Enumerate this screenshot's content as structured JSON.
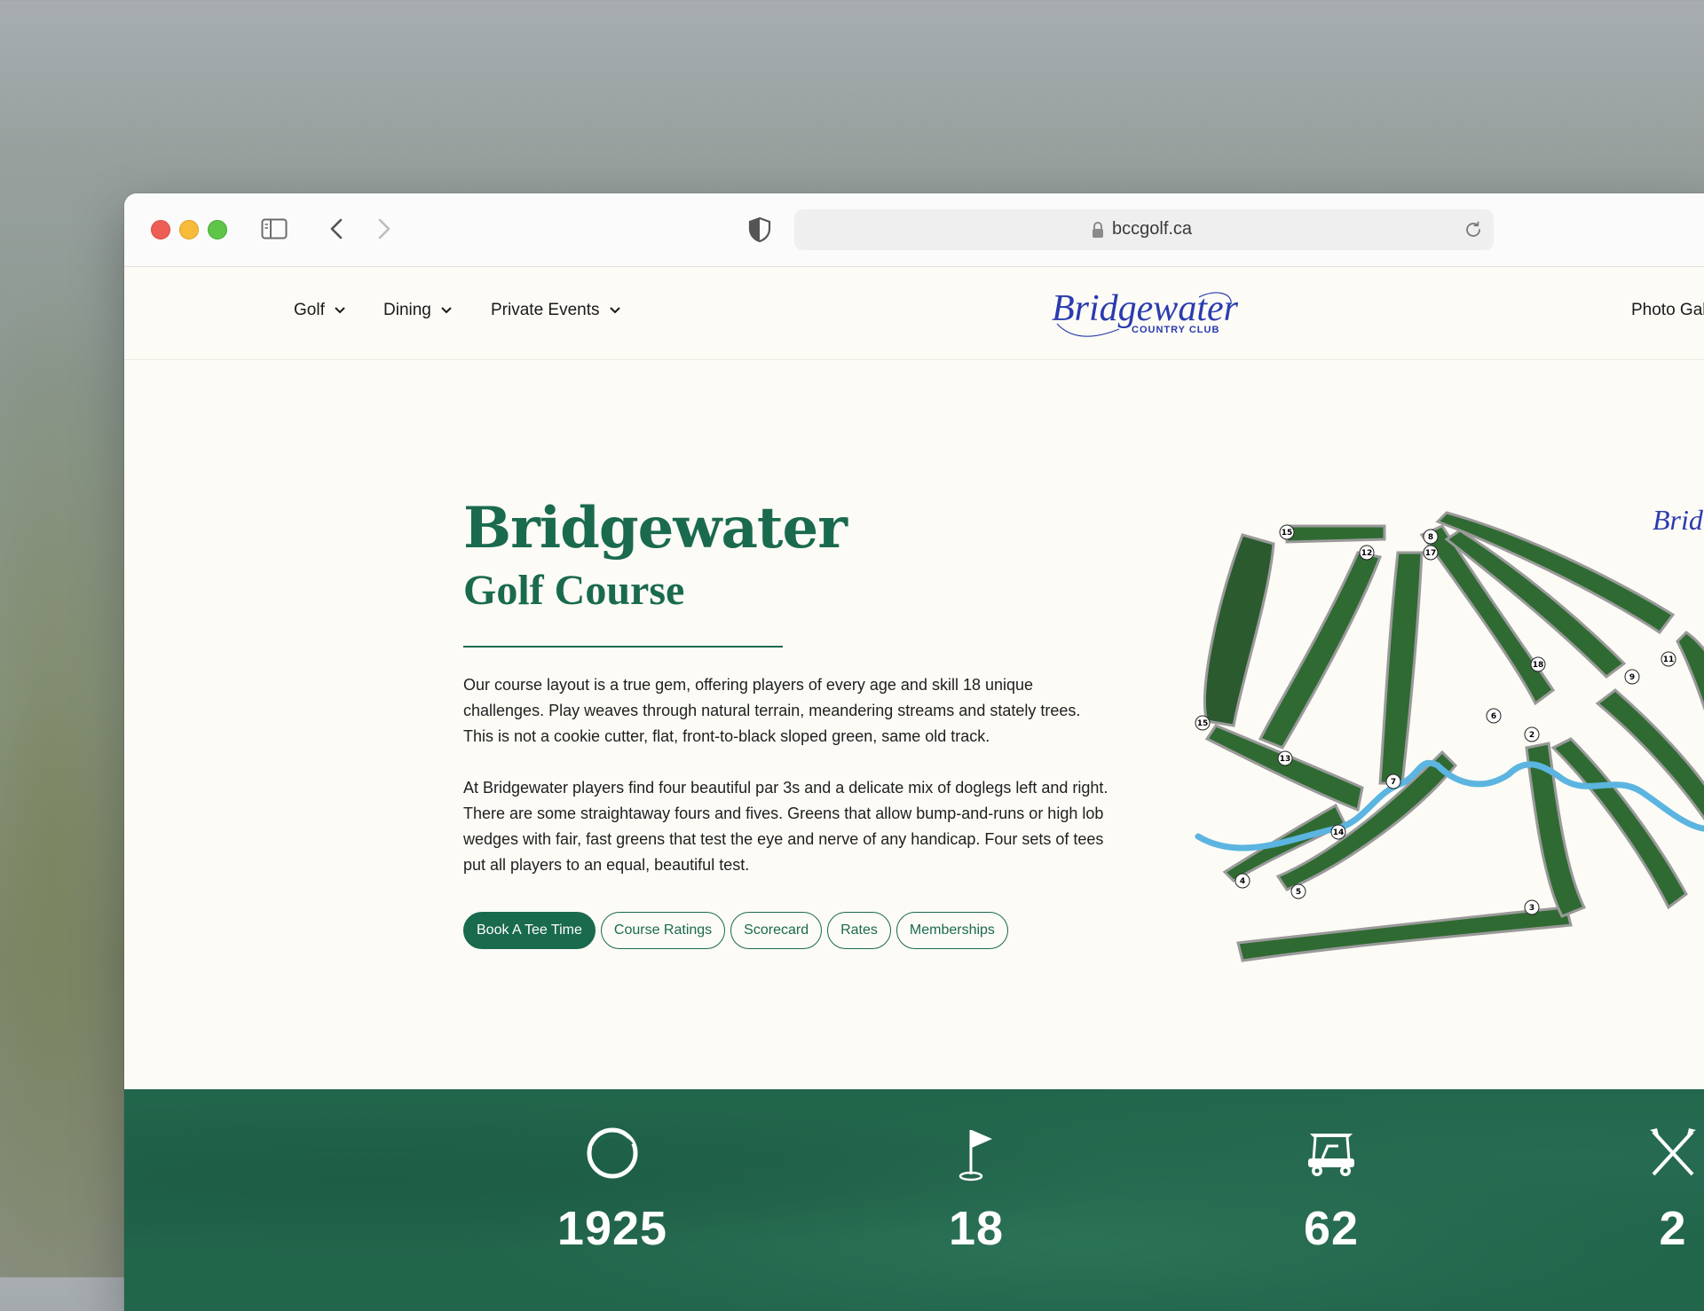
{
  "browser": {
    "url": "bccgolf.ca"
  },
  "nav": {
    "golf": "Golf",
    "dining": "Dining",
    "private_events": "Private Events",
    "photo_gallery": "Photo Gal"
  },
  "logo": {
    "script_text": "Bridgewater",
    "sub_text": "COUNTRY CLUB",
    "color": "#2a3bb0"
  },
  "hero": {
    "title": "Bridgewater",
    "subtitle": "Golf Course",
    "paragraph_1": "Our course layout is a true gem, offering players of every age and skill 18 unique challenges. Play weaves through natural terrain, meandering streams and stately trees. This is not a cookie cutter, flat, front-to-black sloped green, same old track.",
    "paragraph_2": "At Bridgewater players find four beautiful par 3s and a delicate mix of doglegs left and right. There are some straightaway fours and fives. Greens that allow bump-and-runs or high lob wedges with fair, fast greens that test the eye and nerve of any handicap. Four sets of tees put all players to an equal, beautiful test.",
    "buttons": {
      "book": "Book A Tee Time",
      "ratings": "Course Ratings",
      "scorecard": "Scorecard",
      "rates": "Rates",
      "memberships": "Memberships"
    }
  },
  "course_map": {
    "hole_labels": [
      "1",
      "2",
      "3",
      "4",
      "5",
      "6",
      "7",
      "8",
      "9",
      "11",
      "12",
      "13",
      "14",
      "15",
      "16",
      "17",
      "18"
    ],
    "logo_text": "Brid"
  },
  "stats": [
    {
      "icon": "ring-icon",
      "value": "1925"
    },
    {
      "icon": "flag-icon",
      "value": "18"
    },
    {
      "icon": "golf-cart-icon",
      "value": "62"
    },
    {
      "icon": "crossed-clubs-icon",
      "value": "2"
    }
  ],
  "colors": {
    "brand_green": "#1a6a4e",
    "page_bg": "#fcfbf6",
    "water_blue": "#5bb5e0"
  }
}
